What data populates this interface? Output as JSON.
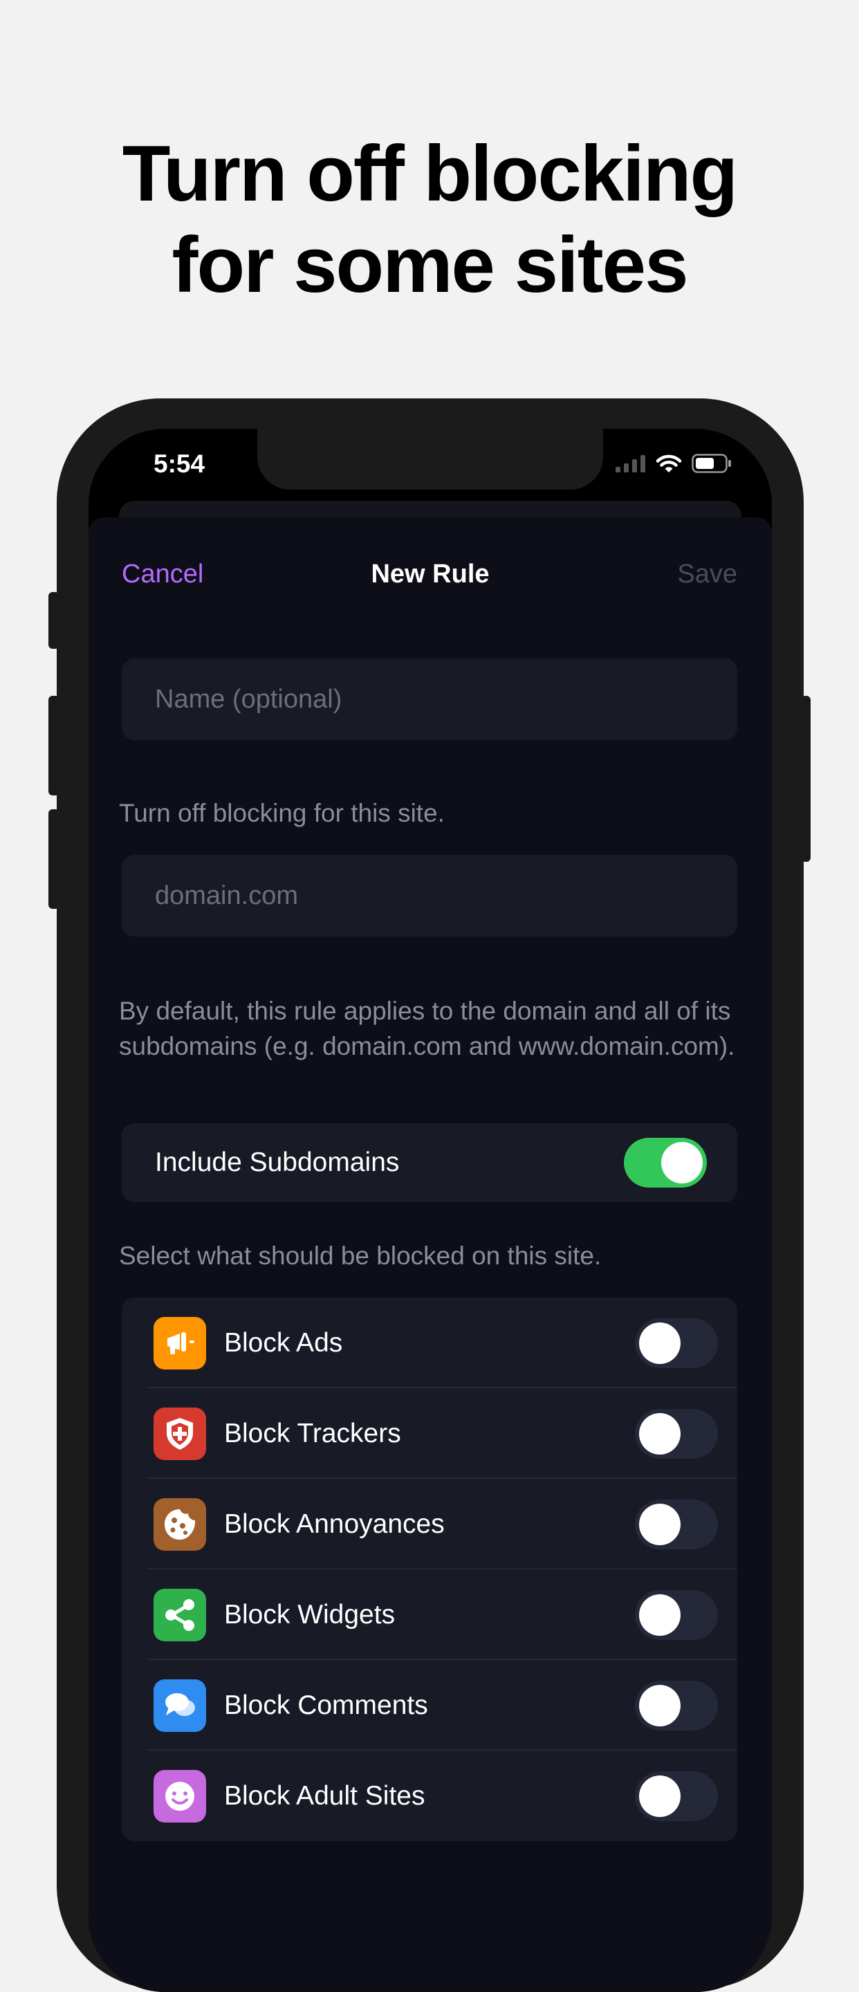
{
  "headline": {
    "line1": "Turn off blocking",
    "line2": "for some sites"
  },
  "status_bar": {
    "time": "5:54"
  },
  "nav": {
    "cancel": "Cancel",
    "title": "New Rule",
    "save": "Save"
  },
  "form": {
    "name_placeholder": "Name (optional)",
    "site_caption": "Turn off blocking for this site.",
    "domain_placeholder": "domain.com",
    "default_caption": "By default, this rule applies to the domain and all of its subdomains (e.g. domain.com and www.domain.com).",
    "include_subdomains": {
      "label": "Include Subdomains",
      "on": true
    },
    "select_caption": "Select what should be blocked on this site."
  },
  "block_options": [
    {
      "label": "Block Ads",
      "icon": "megaphone-icon",
      "color": "#ff9500",
      "on": false
    },
    {
      "label": "Block Trackers",
      "icon": "shield-icon",
      "color": "#d63a2f",
      "on": false
    },
    {
      "label": "Block Annoyances",
      "icon": "cookie-icon",
      "color": "#a2602c",
      "on": false
    },
    {
      "label": "Block Widgets",
      "icon": "share-icon",
      "color": "#2fb24c",
      "on": false
    },
    {
      "label": "Block Comments",
      "icon": "comment-bubbles-icon",
      "color": "#2f8cf0",
      "on": false
    },
    {
      "label": "Block Adult Sites",
      "icon": "smiley-icon",
      "color": "#c86adf",
      "on": false
    }
  ],
  "colors": {
    "accent": "#b36bff",
    "toggle_on": "#33c759",
    "sheet_background": "#0d0e17",
    "cell_background": "#181a26"
  }
}
